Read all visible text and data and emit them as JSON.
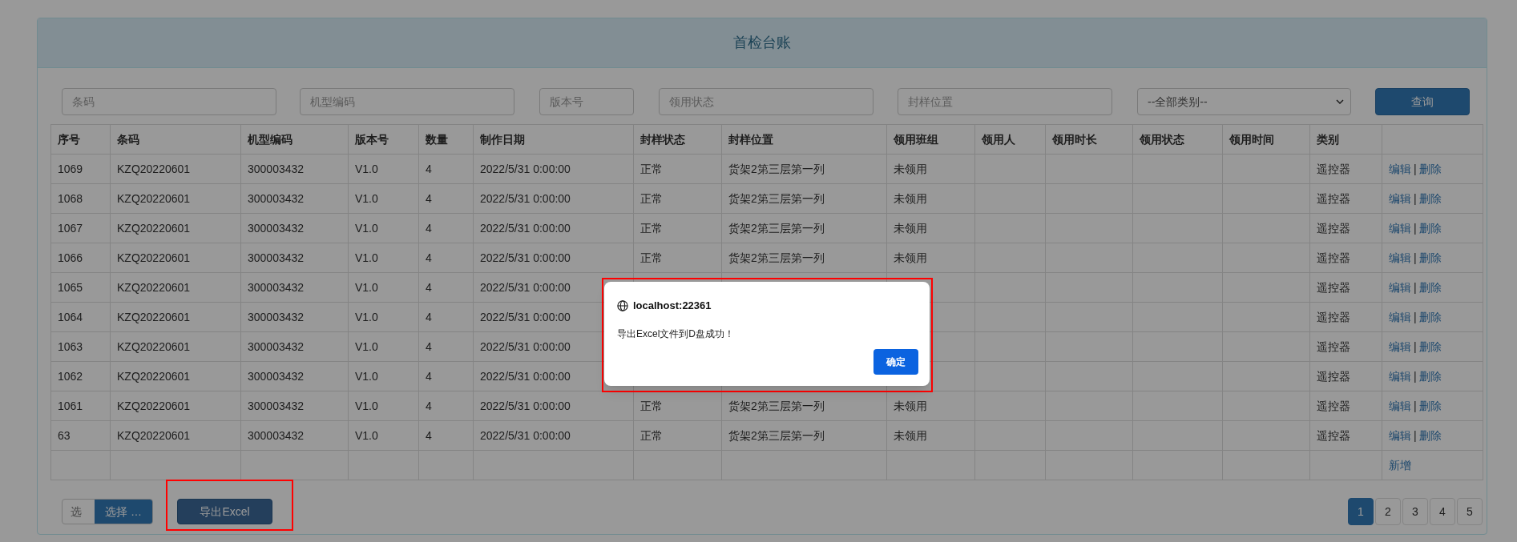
{
  "panel": {
    "title": "首检台账"
  },
  "filters": [
    {
      "kind": "input",
      "placeholder": "条码"
    },
    {
      "kind": "input",
      "placeholder": "机型编码"
    },
    {
      "kind": "input",
      "placeholder": "版本号"
    },
    {
      "kind": "input",
      "placeholder": "领用状态"
    },
    {
      "kind": "input",
      "placeholder": "封样位置"
    },
    {
      "kind": "select",
      "value": "--全部类别--"
    },
    {
      "kind": "button",
      "label": "查询"
    }
  ],
  "table": {
    "columns": [
      "序号",
      "条码",
      "机型编码",
      "版本号",
      "数量",
      "制作日期",
      "封样状态",
      "封样位置",
      "领用班组",
      "领用人",
      "领用时长",
      "领用状态",
      "领用时间",
      "类别"
    ],
    "rows": [
      {
        "cells": [
          "1069",
          "KZQ20220601",
          "300003432",
          "V1.0",
          "4",
          "2022/5/31 0:00:00",
          "正常",
          "货架2第三层第一列",
          "未领用",
          null,
          null,
          null,
          null,
          "遥控器"
        ],
        "actions": [
          "编辑",
          "|",
          "删除"
        ]
      },
      {
        "cells": [
          "1068",
          "KZQ20220601",
          "300003432",
          "V1.0",
          "4",
          "2022/5/31 0:00:00",
          "正常",
          "货架2第三层第一列",
          "未领用",
          null,
          null,
          null,
          null,
          "遥控器"
        ],
        "actions": [
          "编辑",
          "|",
          "删除"
        ]
      },
      {
        "cells": [
          "1067",
          "KZQ20220601",
          "300003432",
          "V1.0",
          "4",
          "2022/5/31 0:00:00",
          "正常",
          "货架2第三层第一列",
          "未领用",
          null,
          null,
          null,
          null,
          "遥控器"
        ],
        "actions": [
          "编辑",
          "|",
          "删除"
        ]
      },
      {
        "cells": [
          "1066",
          "KZQ20220601",
          "300003432",
          "V1.0",
          "4",
          "2022/5/31 0:00:00",
          "正常",
          "货架2第三层第一列",
          "未领用",
          null,
          null,
          null,
          null,
          "遥控器"
        ],
        "actions": [
          "编辑",
          "|",
          "删除"
        ]
      },
      {
        "cells": [
          "1065",
          "KZQ20220601",
          "300003432",
          "V1.0",
          "4",
          "2022/5/31 0:00:00",
          null,
          null,
          null,
          null,
          null,
          null,
          null,
          "遥控器"
        ],
        "actions": [
          "编辑",
          "|",
          "删除"
        ]
      },
      {
        "cells": [
          "1064",
          "KZQ20220601",
          "300003432",
          "V1.0",
          "4",
          "2022/5/31 0:00:00",
          null,
          null,
          null,
          null,
          null,
          null,
          null,
          "遥控器"
        ],
        "actions": [
          "编辑",
          "|",
          "删除"
        ]
      },
      {
        "cells": [
          "1063",
          "KZQ20220601",
          "300003432",
          "V1.0",
          "4",
          "2022/5/31 0:00:00",
          null,
          null,
          null,
          null,
          null,
          null,
          null,
          "遥控器"
        ],
        "actions": [
          "编辑",
          "|",
          "删除"
        ]
      },
      {
        "cells": [
          "1062",
          "KZQ20220601",
          "300003432",
          "V1.0",
          "4",
          "2022/5/31 0:00:00",
          null,
          null,
          null,
          null,
          null,
          null,
          null,
          "遥控器"
        ],
        "actions": [
          "编辑",
          "|",
          "删除"
        ]
      },
      {
        "cells": [
          "1061",
          "KZQ20220601",
          "300003432",
          "V1.0",
          "4",
          "2022/5/31 0:00:00",
          "正常",
          "货架2第三层第一列",
          "未领用",
          null,
          null,
          null,
          null,
          "遥控器"
        ],
        "actions": [
          "编辑",
          "|",
          "删除"
        ]
      },
      {
        "cells": [
          "63",
          "KZQ20220601",
          "300003432",
          "V1.0",
          "4",
          "2022/5/31 0:00:00",
          "正常",
          "货架2第三层第一列",
          "未领用",
          null,
          null,
          null,
          null,
          "遥控器"
        ],
        "actions": [
          "编辑",
          "|",
          "删除"
        ]
      },
      {
        "cells": [
          null,
          null,
          null,
          null,
          null,
          null,
          null,
          null,
          null,
          null,
          null,
          null,
          null,
          null
        ],
        "actions": [
          "新增"
        ]
      }
    ]
  },
  "file_picker": {
    "label": "选",
    "button": "选择 …"
  },
  "export_button": {
    "label": "导出Excel",
    "highlighted": true
  },
  "pagination": [
    {
      "label": "1",
      "selected": true
    },
    {
      "label": "2",
      "selected": false
    },
    {
      "label": "3",
      "selected": false
    },
    {
      "label": "4",
      "selected": false
    },
    {
      "label": "5",
      "selected": false
    }
  ],
  "dialog": {
    "title": "localhost:22361",
    "message": "导出Excel文件到D盘成功！",
    "button": "确定",
    "highlighted": true
  }
}
